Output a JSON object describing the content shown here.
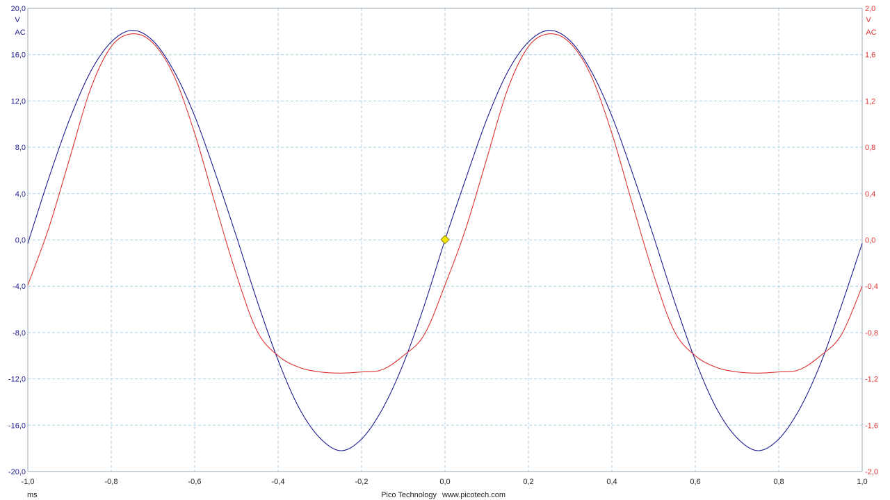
{
  "chart_data": {
    "type": "line",
    "x_unit": "ms",
    "xlim": [
      -1.0,
      1.0
    ],
    "x_ticks": [
      "-1,0",
      "-0,8",
      "-0,6",
      "-0,4",
      "-0,2",
      "0,0",
      "0,2",
      "0,4",
      "0,6",
      "0,8",
      "1,0"
    ],
    "left_axis": {
      "unit": "V",
      "coupling": "AC",
      "ylim": [
        -20.0,
        20.0
      ],
      "color": "#1a1a8c",
      "ticks": [
        "20,0",
        "16,0",
        "12,0",
        "8,0",
        "4,0",
        "0,0",
        "-4,0",
        "-8,0",
        "-12,0",
        "-16,0",
        "-20,0"
      ]
    },
    "right_axis": {
      "unit": "V",
      "coupling": "AC",
      "ylim": [
        -2.0,
        2.0
      ],
      "color": "#dd3333",
      "ticks": [
        "2,0",
        "1,6",
        "1,2",
        "0,8",
        "0,4",
        "0,0",
        "-0,4",
        "-0,8",
        "-1,2",
        "-1,6",
        "-2,0"
      ]
    },
    "grid": true,
    "trigger_marker": {
      "x": 0.0,
      "y": 0.0,
      "color": "#f2e600"
    },
    "series": [
      {
        "axis": "left",
        "color": "#1a1a8c",
        "x": [
          -1.0,
          -0.95,
          -0.9,
          -0.85,
          -0.8,
          -0.75,
          -0.7,
          -0.65,
          -0.6,
          -0.55,
          -0.5,
          -0.45,
          -0.4,
          -0.35,
          -0.3,
          -0.25,
          -0.2,
          -0.15,
          -0.1,
          -0.05,
          0.0,
          0.05,
          0.1,
          0.15,
          0.2,
          0.25,
          0.3,
          0.35,
          0.4,
          0.45,
          0.5,
          0.55,
          0.6,
          0.65,
          0.7,
          0.75,
          0.8,
          0.85,
          0.9,
          0.95,
          1.0
        ],
        "y": [
          -0.3,
          5.3,
          10.4,
          14.5,
          17.1,
          18.1,
          17.2,
          14.6,
          10.7,
          5.7,
          0.3,
          -5.3,
          -10.4,
          -14.5,
          -17.1,
          -18.2,
          -17.2,
          -14.6,
          -10.7,
          -5.7,
          0.0,
          5.3,
          10.4,
          14.5,
          17.1,
          18.1,
          17.2,
          14.6,
          10.7,
          5.7,
          0.3,
          -5.3,
          -10.4,
          -14.5,
          -17.1,
          -18.2,
          -17.2,
          -14.6,
          -10.7,
          -5.7,
          -0.3
        ]
      },
      {
        "axis": "right",
        "color": "#dd3333",
        "x": [
          -1.0,
          -0.95,
          -0.9,
          -0.85,
          -0.8,
          -0.75,
          -0.7,
          -0.65,
          -0.6,
          -0.55,
          -0.5,
          -0.45,
          -0.4,
          -0.35,
          -0.3,
          -0.25,
          -0.2,
          -0.15,
          -0.1,
          -0.05,
          0.0,
          0.05,
          0.1,
          0.15,
          0.2,
          0.25,
          0.3,
          0.35,
          0.4,
          0.45,
          0.5,
          0.55,
          0.6,
          0.65,
          0.7,
          0.75,
          0.8,
          0.85,
          0.9,
          0.95,
          1.0
        ],
        "y": [
          -0.39,
          0.1,
          0.7,
          1.3,
          1.67,
          1.78,
          1.7,
          1.42,
          0.92,
          0.3,
          -0.3,
          -0.79,
          -1.0,
          -1.1,
          -1.14,
          -1.15,
          -1.14,
          -1.12,
          -1.0,
          -0.82,
          -0.39,
          0.1,
          0.7,
          1.3,
          1.67,
          1.78,
          1.7,
          1.42,
          0.92,
          0.3,
          -0.3,
          -0.79,
          -1.0,
          -1.1,
          -1.14,
          -1.15,
          -1.14,
          -1.12,
          -1.0,
          -0.82,
          -0.4
        ]
      }
    ]
  },
  "footer": {
    "x_unit_label": "ms",
    "brand": "Pico Technology",
    "url": "www.picotech.com"
  }
}
